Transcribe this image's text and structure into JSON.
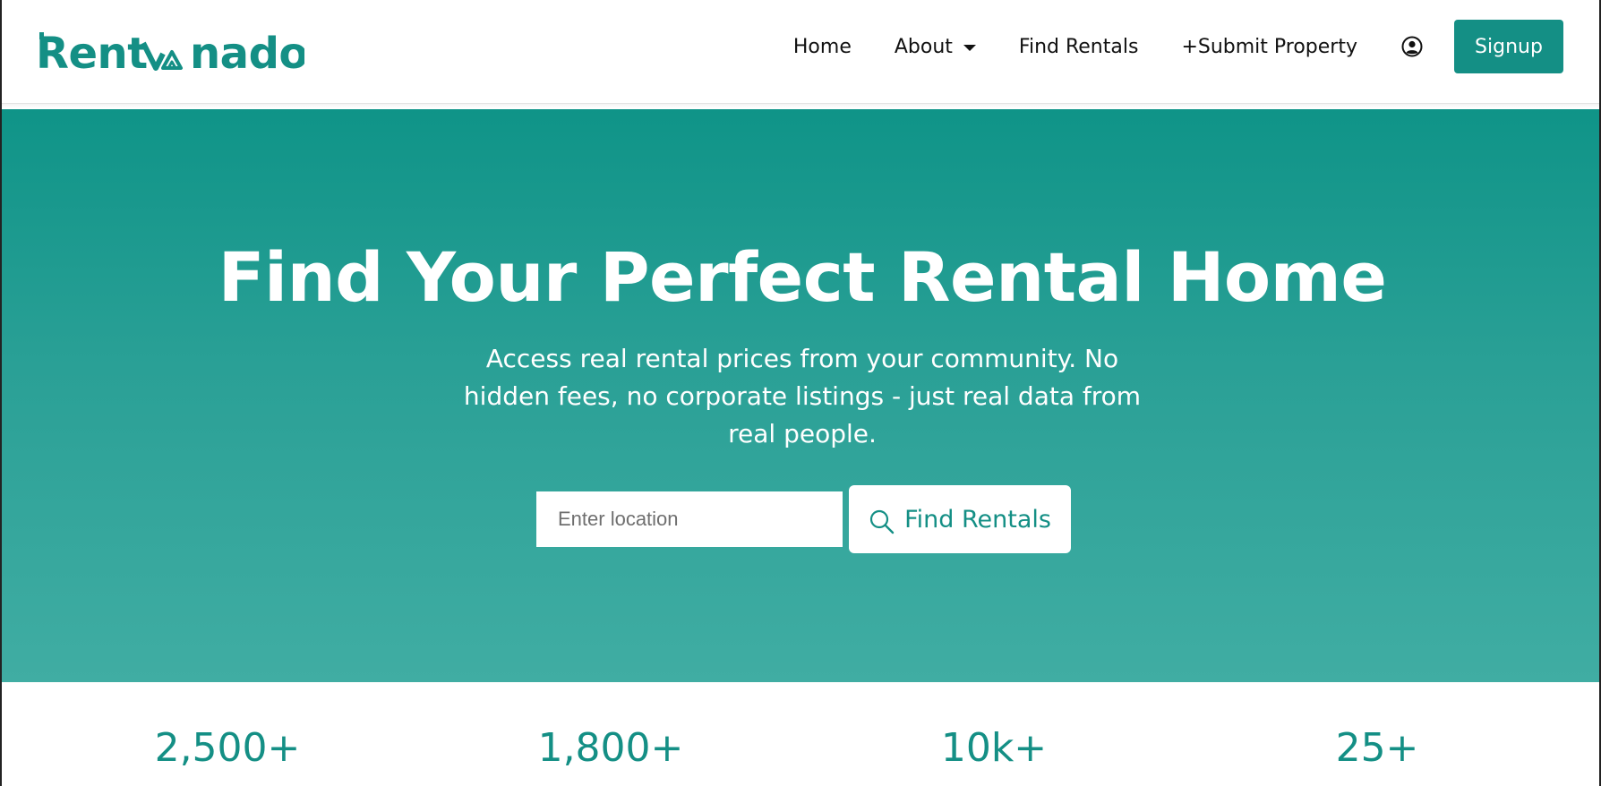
{
  "brand": {
    "name": "Rentvanado",
    "color": "#148f85"
  },
  "nav": {
    "home": "Home",
    "about": "About",
    "find_rentals": "Find Rentals",
    "submit_property": "+Submit Property",
    "user_icon": "user-circle-icon",
    "signup": "Signup"
  },
  "hero": {
    "title": "Find Your Perfect Rental Home",
    "subtitle": "Access real rental prices from your community. No hidden fees, no corporate listings - just real data from real people.",
    "search": {
      "placeholder": "Enter location",
      "value": "",
      "button_label": "Find Rentals",
      "button_icon": "search-icon"
    },
    "gradient_top": "#0f9488",
    "gradient_bottom": "#40ada3"
  },
  "stats": [
    {
      "value": "2,500+"
    },
    {
      "value": "1,800+"
    },
    {
      "value": "10k+"
    },
    {
      "value": "25+"
    }
  ]
}
